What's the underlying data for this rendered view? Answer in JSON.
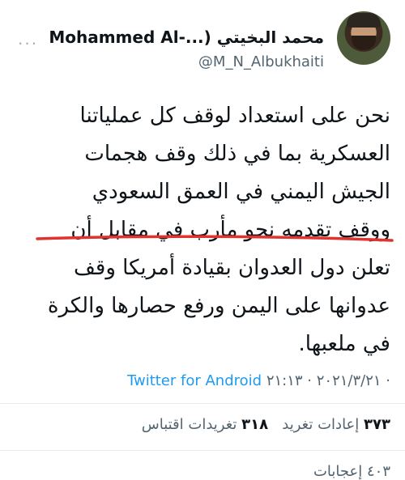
{
  "header": {
    "display_name": "Mohammed Al-...) محمد البخيتي",
    "handle": "@M_N_Albukhaiti",
    "more_label": "..."
  },
  "tweet": {
    "lines": [
      "نحن على استعداد لوقف كل عملياتنا",
      "العسكرية بما في ذلك وقف هجمات",
      "الجيش اليمني في العمق السعودي",
      "ووقف تقدمه نحو مأرب في مقابل أن",
      "تعلن دول العدوان بقيادة أمريكا وقف",
      "عدوانها على اليمن ورفع حصارها والكرة",
      "في ملعبها."
    ],
    "underline_color": "#e0322f"
  },
  "meta": {
    "timestamp": "٢٠٢١/٣/٢١ · ٢١:١٣ ·",
    "source": "Twitter for Android"
  },
  "stats": {
    "retweets_count": "٣٧٣",
    "retweets_label": "إعادات تغريد",
    "quotes_count": "٣١٨",
    "quotes_label": "تغريدات اقتباس"
  },
  "next_row": {
    "text": "٤٠٣ إعجابات"
  },
  "colors": {
    "accent": "#1d9bf0",
    "secondary_text": "#536471",
    "primary_text": "#0f1419"
  }
}
